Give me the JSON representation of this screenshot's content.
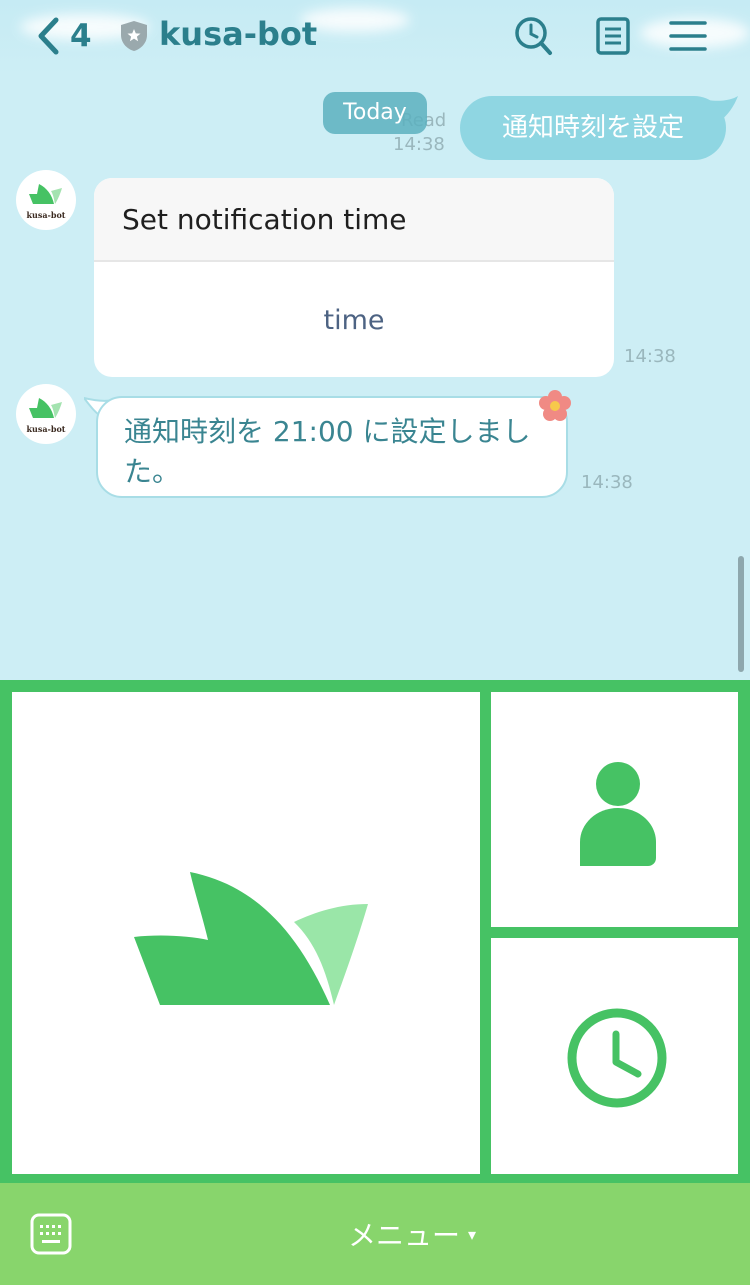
{
  "header": {
    "back_count": "4",
    "title": "kusa-bot"
  },
  "chat": {
    "date_pill": "Today",
    "sent_message": {
      "text": "通知時刻を設定",
      "read_label": "Read",
      "time": "14:38"
    },
    "card_message": {
      "title": "Set notification time",
      "button_label": "time",
      "time": "14:38"
    },
    "reply_message": {
      "text": "通知時刻を 21:00 に設定しました。",
      "time": "14:38"
    },
    "bot_avatar_text": "kusa-bot"
  },
  "bottom_bar": {
    "menu_label": "メニュー",
    "menu_arrow": "▾"
  },
  "colors": {
    "accent_green": "#46c264",
    "bottom_bar_green": "#88d56c",
    "header_teal": "#2b7f8c",
    "chat_background": "#cdeef5",
    "sent_bubble": "#8fd6e2"
  },
  "icons": {
    "back": "chevron-left-icon",
    "official_badge": "shield-star-icon",
    "search": "search-icon",
    "notes": "notes-icon",
    "menu": "hamburger-menu-icon",
    "profile": "person-icon",
    "clock": "clock-icon",
    "keyboard": "keyboard-icon",
    "decoration": "flower-icon"
  }
}
